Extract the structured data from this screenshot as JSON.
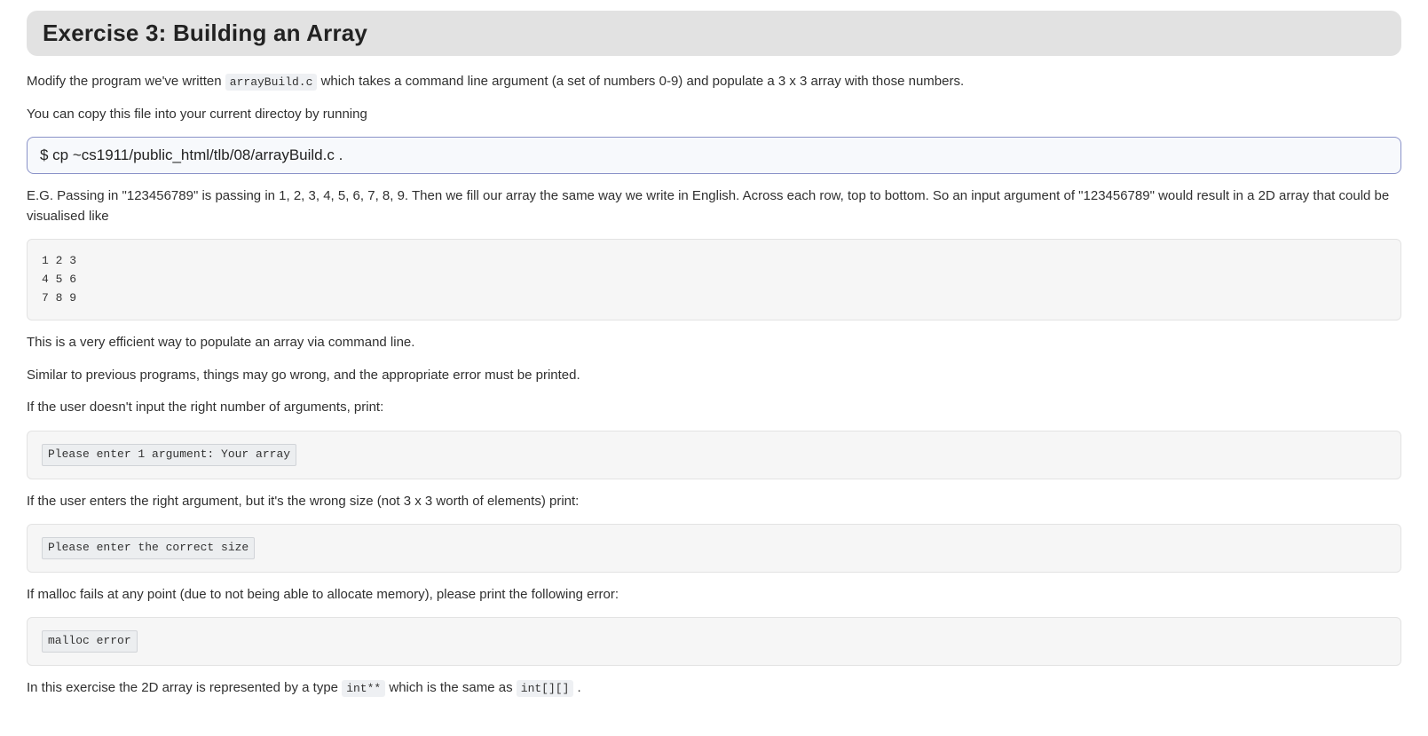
{
  "header": {
    "title": "Exercise 3: Building an Array"
  },
  "intro": {
    "before_code": "Modify the program we've written ",
    "code": "arrayBuild.c",
    "after_code": " which takes a command line argument (a set of numbers 0-9) and populate a 3 x 3 array with those numbers."
  },
  "copy_instruction": "You can copy this file into your current directoy by running",
  "copy_command": "$ cp ~cs1911/public_html/tlb/08/arrayBuild.c .",
  "eg_text": "E.G. Passing in \"123456789\" is passing in 1, 2, 3, 4, 5, 6, 7, 8, 9. Then we fill our array the same way we write in English. Across each row, top to bottom. So an input argument of \"123456789\" would result in a 2D array that could be visualised like",
  "matrix_block": "1 2 3\n4 5 6\n7 8 9",
  "efficient_text": "This is a very efficient way to populate an array via command line.",
  "similar_text": "Similar to previous programs, things may go wrong, and the appropriate error must be printed.",
  "argcount_text": "If the user doesn't input the right number of arguments, print:",
  "argcount_msg": "Please enter 1 argument: Your array",
  "wrongsize_text": "If the user enters the right argument, but it's the wrong size (not 3 x 3 worth of elements) print:",
  "wrongsize_msg": "Please enter the correct size",
  "malloc_text": "If malloc fails at any point (due to not being able to allocate memory), please print the following error:",
  "malloc_msg": "malloc error",
  "closing": {
    "before_code1": "In this exercise the 2D array is represented by a type ",
    "code1": "int**",
    "mid": " which is the same as ",
    "code2": "int[][]",
    "after": " ."
  }
}
